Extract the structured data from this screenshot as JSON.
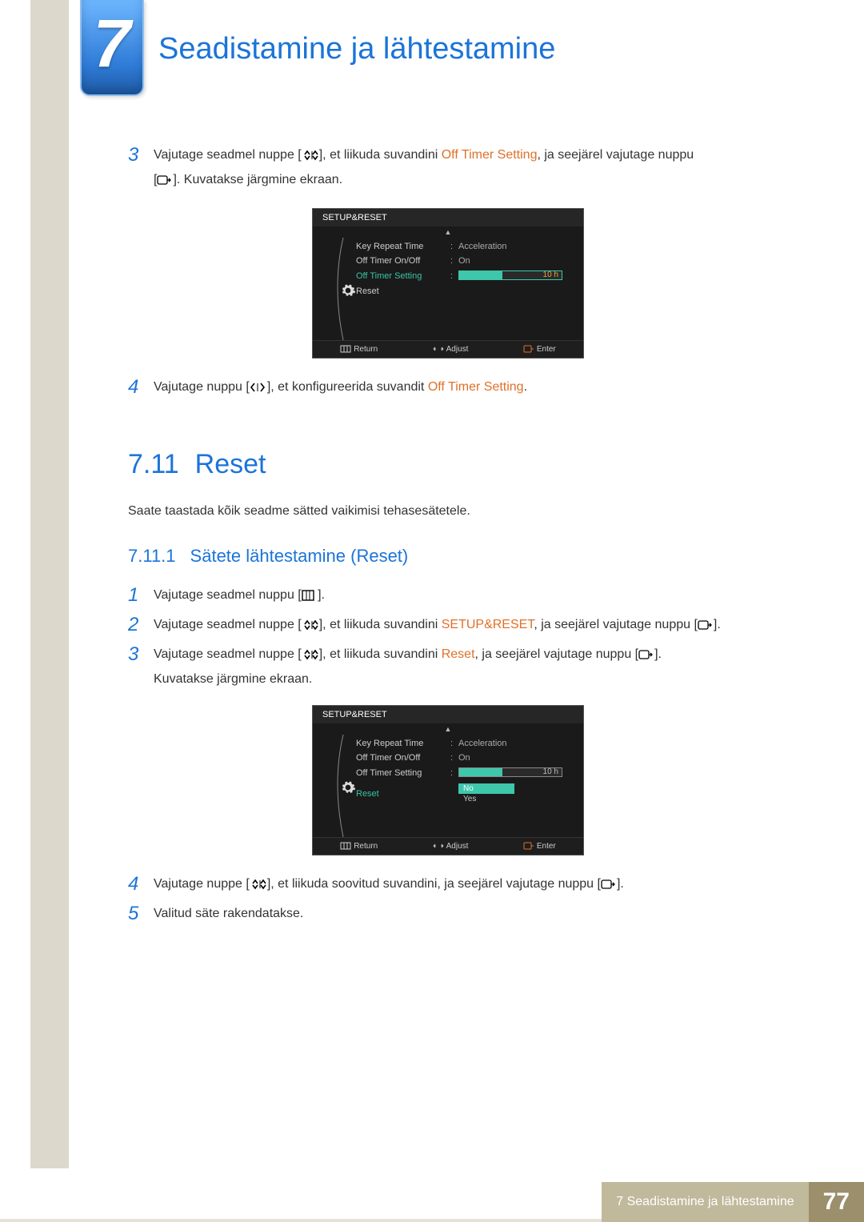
{
  "chapter": {
    "number": "7",
    "title": "Seadistamine ja lähtestamine"
  },
  "steps_a": {
    "3": {
      "pre": "Vajutage seadmel nuppe [",
      "mid": "], et liikuda suvandini ",
      "hl": "Off Timer Setting",
      "post": ", ja seejärel vajutage nuppu",
      "line2a": "[",
      "line2b": "]. Kuvatakse järgmine ekraan."
    },
    "4": {
      "pre": "Vajutage nuppu [",
      "mid": "], et konfigureerida suvandit ",
      "hl": "Off Timer Setting",
      "post": "."
    }
  },
  "section": {
    "num": "7.11",
    "title": "Reset"
  },
  "intro": "Saate taastada kõik seadme sätted vaikimisi tehasesätetele.",
  "subsection": {
    "num": "7.11.1",
    "title": "Sätete lähtestamine (Reset)"
  },
  "steps_b": {
    "1": {
      "pre": "Vajutage seadmel nuppu [",
      "post": " ]."
    },
    "2": {
      "pre": "Vajutage seadmel nuppe [",
      "mid": "], et liikuda suvandini ",
      "hl": "SETUP&RESET",
      "post": ", ja seejärel vajutage nuppu [",
      "tail": "]."
    },
    "3": {
      "pre": "Vajutage seadmel nuppe [",
      "mid": "], et liikuda suvandini ",
      "hl": "Reset",
      "post": ", ja seejärel vajutage nuppu [",
      "tail": "].",
      "line2": "Kuvatakse järgmine ekraan."
    },
    "4": {
      "pre": "Vajutage nuppe [",
      "mid": "], et liikuda soovitud suvandini, ja seejärel vajutage nuppu [",
      "post": "]."
    },
    "5": {
      "text": "Valitud säte rakendatakse."
    }
  },
  "osd": {
    "title": "SETUP&RESET",
    "rows": {
      "keyRepeat": {
        "label": "Key Repeat Time",
        "value": "Acceleration"
      },
      "offOnOff": {
        "label": "Off Timer On/Off",
        "value": "On"
      },
      "offSetting": {
        "label": "Off Timer Setting",
        "value": "10 h"
      },
      "reset": {
        "label": "Reset"
      }
    },
    "dropdown": {
      "no": "No",
      "yes": "Yes"
    },
    "footer": {
      "return": "Return",
      "adjust": "Adjust",
      "enter": "Enter"
    }
  },
  "footer": {
    "text": "7 Seadistamine ja lähtestamine",
    "page": "77"
  },
  "chart_data": null
}
